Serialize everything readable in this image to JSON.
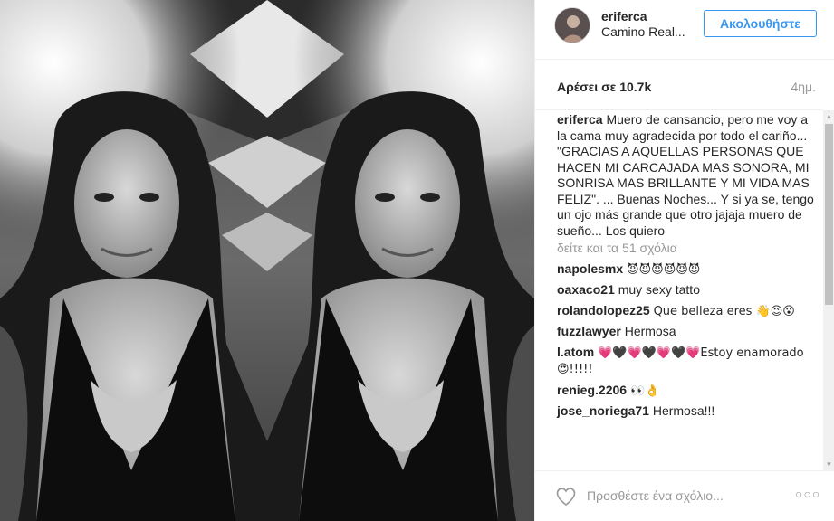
{
  "header": {
    "username": "eriferca",
    "location": "Camino Real...",
    "follow_label": "Ακολουθήστε"
  },
  "stats": {
    "likes": "Αρέσει σε 10.7k",
    "time": "4ημ."
  },
  "caption": {
    "username": "eriferca",
    "text": "Muero de cansancio, pero me voy a la cama muy agradecida por todo el cariño... \"GRACIAS A AQUELLAS PERSONAS QUE HACEN MI CARCAJADA MAS SONORA, MI SONRISA MAS BRILLANTE Y MI VIDA MAS FELIZ\". ... Buenas Noches... Y si ya se, tengo un ojo más grande que otro jajaja muero de sueño... Los quiero"
  },
  "view_all_comments": "δείτε και τα 51 σχόλια",
  "comments": [
    {
      "user": "napolesmx",
      "text": "😈😈😈😈😈😈"
    },
    {
      "user": "oaxaco21",
      "text": "muy sexy tatto"
    },
    {
      "user": "rolandolopez25",
      "text": "Que belleza eres 👋😉😮"
    },
    {
      "user": "fuzzlawyer",
      "text": "Hermosa"
    },
    {
      "user": "l.atom",
      "text": "💗🖤💗🖤💗🖤💗Estoy enamorado 😍!!!!!"
    },
    {
      "user": "renieg.2206",
      "text": "👀👌"
    },
    {
      "user": "jose_noriega71",
      "text": "Hermosa!!!"
    }
  ],
  "footer": {
    "comment_placeholder": "Προσθέστε ένα σχόλιο...",
    "more_label": "○○○"
  },
  "colors": {
    "accent": "#3897f0",
    "muted": "#999999",
    "text": "#262626"
  }
}
